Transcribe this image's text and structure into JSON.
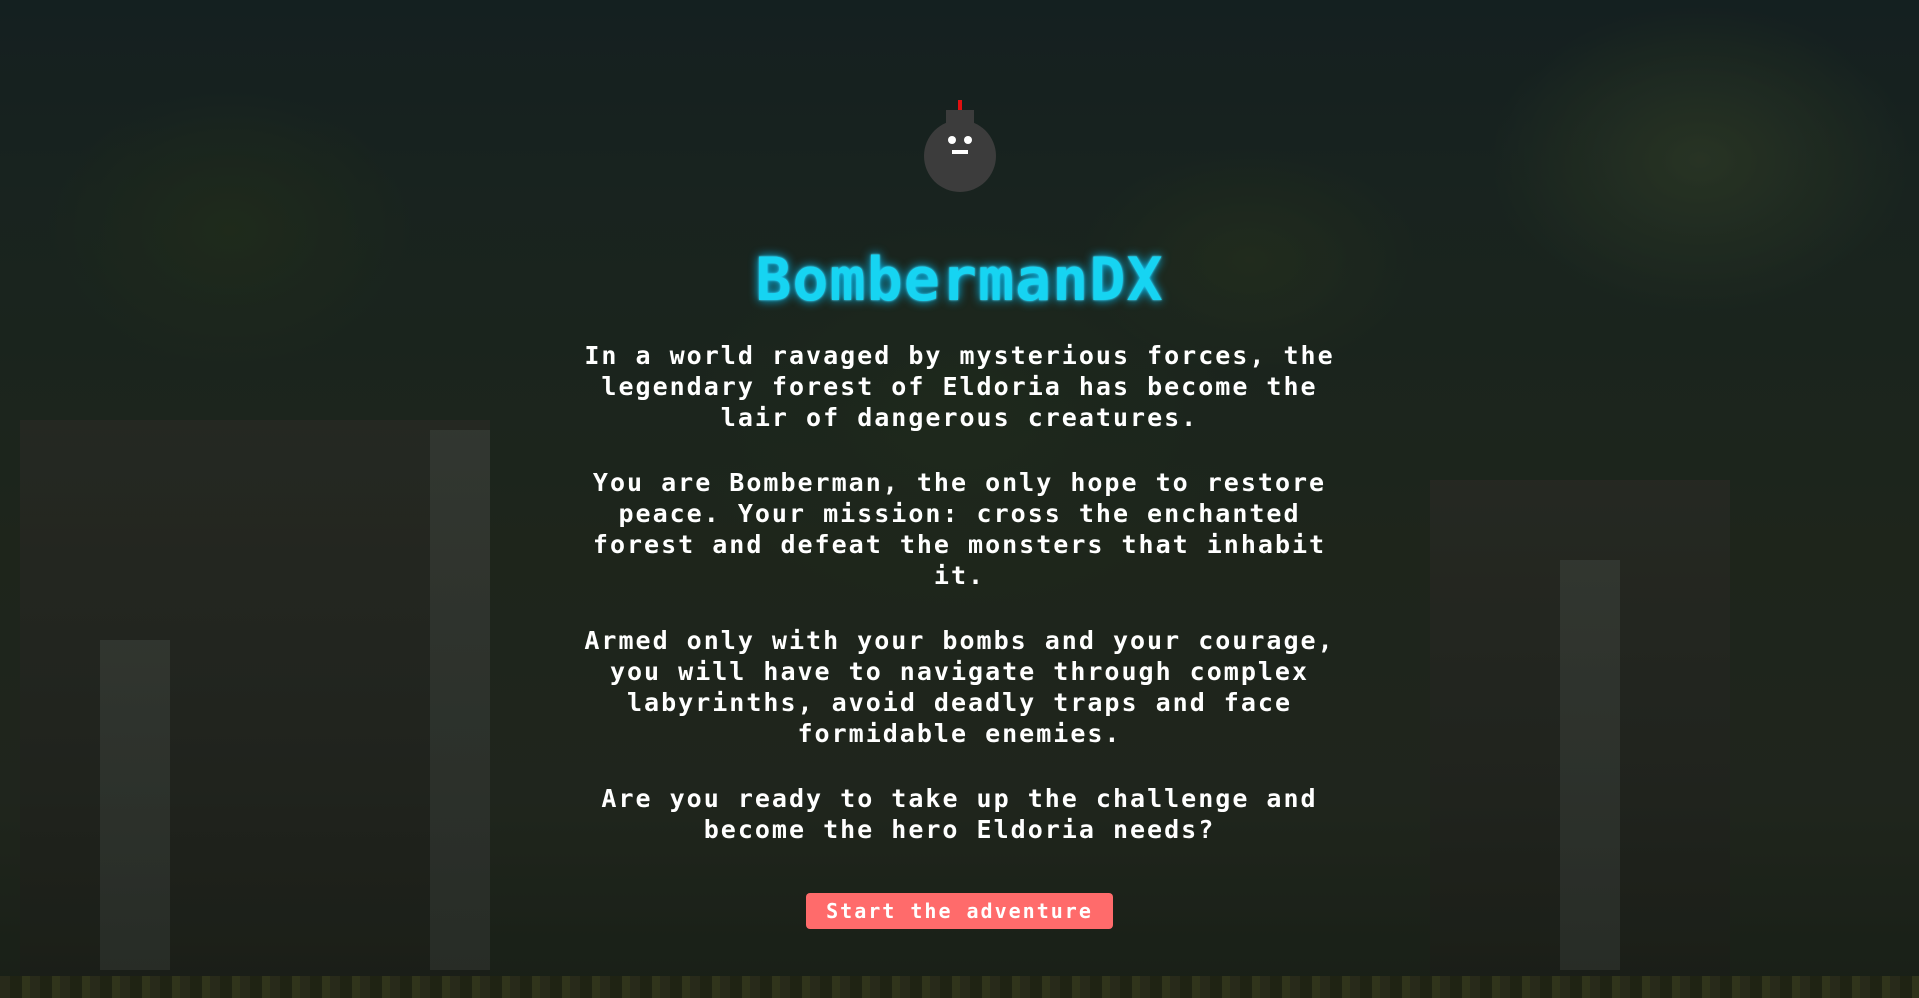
{
  "game": {
    "title": "BombermanDX",
    "story": [
      "In a world ravaged by mysterious forces, the legendary forest of Eldoria has become the lair of dangerous creatures.",
      "You are Bomberman, the only hope to restore peace. Your mission: cross the enchanted forest and defeat the monsters that inhabit it.",
      "Armed only with your bombs and your courage, you will have to navigate through complex labyrinths, avoid deadly traps and face formidable enemies.",
      "Are you ready to take up the challenge and become the hero Eldoria needs?"
    ],
    "start_button_label": "Start the adventure"
  },
  "colors": {
    "title": "#16d4f2",
    "button": "#ff6b6b",
    "bomb": "#3c3c3c",
    "fuse": "#e01010"
  },
  "icons": {
    "logo": "bomb-icon"
  }
}
